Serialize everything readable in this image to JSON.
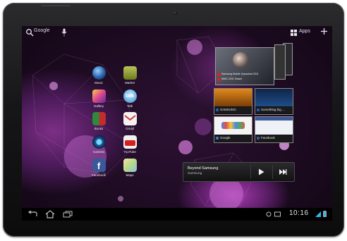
{
  "colors": {
    "accent": "#33b5e5",
    "wallpaper": "#4a1a58",
    "bezel": "#161618"
  },
  "topbar": {
    "search_label": "Google",
    "apps_label": "Apps"
  },
  "apps": [
    {
      "label": "Music",
      "icon": "music-icon"
    },
    {
      "label": "Market",
      "icon": "market-icon"
    },
    {
      "label": "Gallery",
      "icon": "gallery-icon"
    },
    {
      "label": "Talk",
      "icon": "talk-icon"
    },
    {
      "label": "Books",
      "icon": "books-icon"
    },
    {
      "label": "Gmail",
      "icon": "gmail-icon"
    },
    {
      "label": "Camera",
      "icon": "camera-icon"
    },
    {
      "label": "YouTube",
      "icon": "youtube-icon"
    },
    {
      "label": "Facebook",
      "icon": "facebook-icon"
    },
    {
      "label": "Maps",
      "icon": "maps-icon"
    }
  ],
  "youtube_widget": {
    "line1": "Samsung Mobile Unpacked 2011",
    "line2": "MWC 2011 Teaser"
  },
  "bookmarks": [
    {
      "label": "SAMSUNG"
    },
    {
      "label": "Something big ..."
    },
    {
      "label": "Google"
    },
    {
      "label": "Facebook"
    }
  ],
  "music_widget": {
    "title": "Beyond Samsung",
    "artist": "Samsung"
  },
  "status": {
    "time": "10:16"
  }
}
